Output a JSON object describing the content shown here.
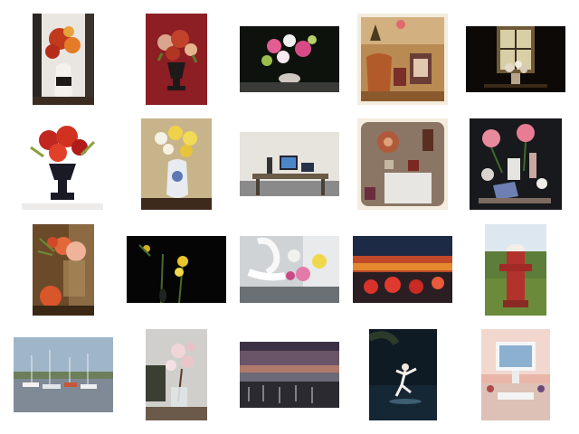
{
  "gallery": {
    "thumbnails": [
      {
        "subject": "red-and-orange-bouquet-in-white-vase"
      },
      {
        "subject": "roses-in-dark-urn-on-red-wall"
      },
      {
        "subject": "pink-lily-bouquet-on-dark-table"
      },
      {
        "subject": "copper-pots-on-shelf"
      },
      {
        "subject": "flowers-on-window-sill-at-night"
      },
      {
        "subject": "red-roses-in-black-urn"
      },
      {
        "subject": "daffodils-in-blue-vase"
      },
      {
        "subject": "computer-desk-workspace"
      },
      {
        "subject": "kitchen-wall-clock-and-cabinet"
      },
      {
        "subject": "pink-roses-still-life-dark"
      },
      {
        "subject": "orange-roses-with-persimmon"
      },
      {
        "subject": "yellow-daffodils-on-black"
      },
      {
        "subject": "lilies-behind-white-chair"
      },
      {
        "subject": "sunset-over-red-canopies"
      },
      {
        "subject": "red-fire-hydrant-on-grass"
      },
      {
        "subject": "sailboat-marina"
      },
      {
        "subject": "cherry-blossom-branch-in-glass"
      },
      {
        "subject": "purple-sunset-over-pier"
      },
      {
        "subject": "leaping-figure-at-night"
      },
      {
        "subject": "glowing-imac-on-desk"
      }
    ]
  }
}
